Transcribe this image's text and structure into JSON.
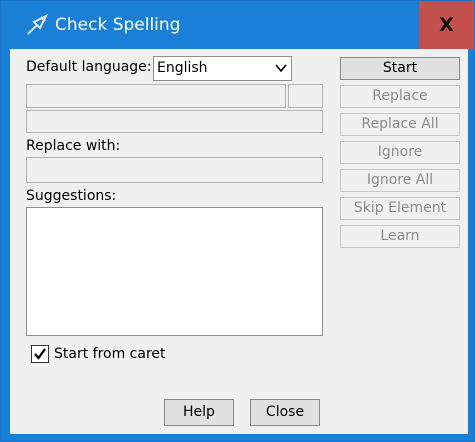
{
  "window": {
    "title": "Check Spelling",
    "close_label": "X",
    "titlebar_color": "#1a7fd6",
    "close_color": "#c4504e"
  },
  "form": {
    "default_language_label": "Default language:",
    "language_value": "English",
    "replace_with_label": "Replace with:",
    "suggestions_label": "Suggestions:",
    "start_from_caret_label": "Start from caret",
    "start_from_caret_checked": true
  },
  "actions": {
    "start": "Start",
    "replace": "Replace",
    "replace_all": "Replace All",
    "ignore": "Ignore",
    "ignore_all": "Ignore All",
    "skip_element": "Skip Element",
    "learn": "Learn"
  },
  "footer": {
    "help": "Help",
    "close": "Close"
  }
}
